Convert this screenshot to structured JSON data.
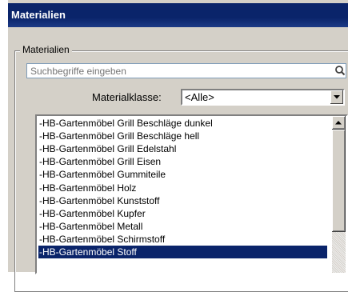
{
  "window": {
    "title": "Materialien"
  },
  "group": {
    "label": "Materialien"
  },
  "search": {
    "placeholder": "Suchbegriffe eingeben"
  },
  "material_class": {
    "label": "Materialklasse:",
    "value": "<Alle>"
  },
  "materials": [
    "-HB-Gartenmöbel Grill Beschläge dunkel",
    "-HB-Gartenmöbel Grill Beschläge hell",
    "-HB-Gartenmöbel Grill Edelstahl",
    "-HB-Gartenmöbel Grill Eisen",
    "-HB-Gartenmöbel Gummiteile",
    "-HB-Gartenmöbel Holz",
    "-HB-Gartenmöbel Kunststoff",
    "-HB-Gartenmöbel Kupfer",
    "-HB-Gartenmöbel Metall",
    "-HB-Gartenmöbel Schirmstoff",
    "-HB-Gartenmöbel Stoff"
  ],
  "selected_material": "-HB-Gartenmöbel Stoff"
}
